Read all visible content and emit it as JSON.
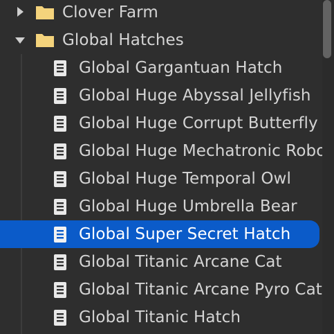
{
  "tree": {
    "folders": [
      {
        "label": "Clover Farm",
        "expanded": false
      },
      {
        "label": "Global Hatches",
        "expanded": true
      }
    ],
    "items": [
      {
        "label": "Global Gargantuan Hatch"
      },
      {
        "label": "Global Huge Abyssal Jellyfish"
      },
      {
        "label": "Global Huge Corrupt Butterfly"
      },
      {
        "label": "Global Huge Mechatronic Robot"
      },
      {
        "label": "Global Huge Temporal Owl"
      },
      {
        "label": "Global Huge Umbrella Bear"
      },
      {
        "label": "Global Super Secret Hatch",
        "selected": true
      },
      {
        "label": "Global Titanic Arcane Cat"
      },
      {
        "label": "Global Titanic Arcane Pyro Cat"
      },
      {
        "label": "Global Titanic Hatch"
      }
    ]
  },
  "colors": {
    "background": "#2e2e2e",
    "text": "#d4d4d4",
    "selection": "#0b5bc9",
    "folder": "#f4d37c"
  },
  "icons": {
    "folder": "folder-icon",
    "file": "script-file-icon",
    "collapsed": "chevron-right-icon",
    "expanded": "chevron-down-icon"
  }
}
